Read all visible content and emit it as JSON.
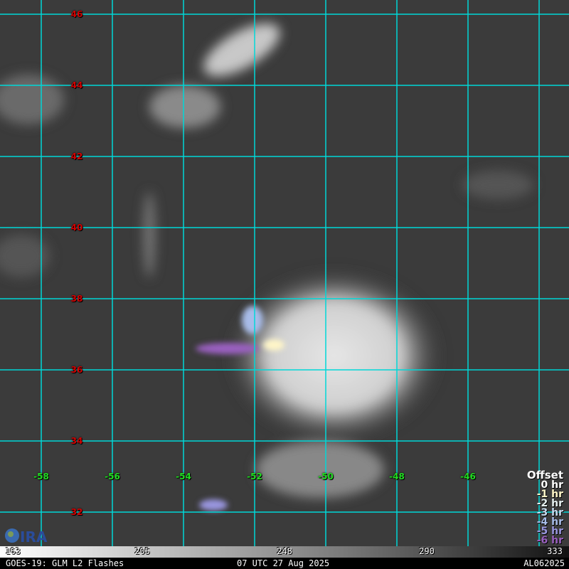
{
  "latitudes": [
    "46",
    "44",
    "42",
    "40",
    "38",
    "36",
    "34",
    "32"
  ],
  "longitudes": [
    "-58",
    "-56",
    "-54",
    "-52",
    "-50",
    "-48",
    "-46"
  ],
  "legend": {
    "title": "Offset",
    "items": [
      {
        "label": "0 hr",
        "color": "#ffffff"
      },
      {
        "label": "-1 hr",
        "color": "#fff6c8"
      },
      {
        "label": "-2 hr",
        "color": "#e6f0f0"
      },
      {
        "label": "-3 hr",
        "color": "#c8dcf0"
      },
      {
        "label": "-4 hr",
        "color": "#a8bce8"
      },
      {
        "label": "-5 hr",
        "color": "#9a96e0"
      },
      {
        "label": "-6 hr",
        "color": "#9a60c0"
      }
    ]
  },
  "colorbar": {
    "ticks": [
      "163",
      "205",
      "248",
      "290",
      "333"
    ]
  },
  "footer": {
    "left": "GOES-19: GLM L2 Flashes",
    "center": "07 UTC 27 Aug 2025",
    "right": "AL062025"
  },
  "logo_text": "CIRA"
}
